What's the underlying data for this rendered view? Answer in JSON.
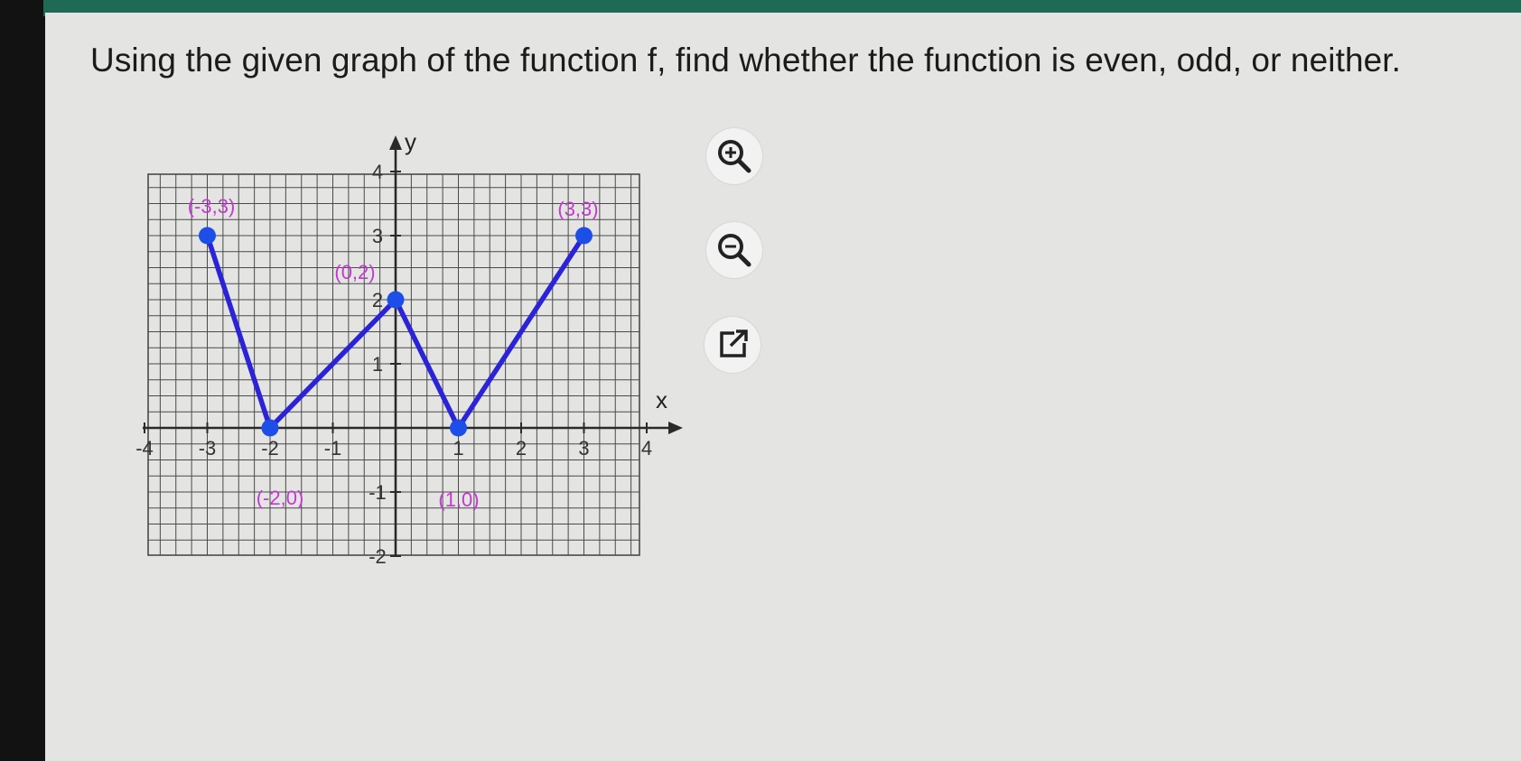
{
  "question": {
    "text": "Using the given graph of the function f, find whether the function is even, odd, or neither."
  },
  "graph": {
    "axis_labels": {
      "x": "x",
      "y": "y"
    },
    "x_ticks": [
      "-4",
      "-3",
      "-2",
      "-1",
      "1",
      "2",
      "3",
      "4"
    ],
    "y_ticks": [
      "4",
      "3",
      "2",
      "1",
      "-1",
      "-2"
    ],
    "point_labels": [
      "(-3,3)",
      "(0,2)",
      "(3,3)",
      "(-2,0)",
      "(1,0)"
    ],
    "colors": {
      "line": "#2b23d8",
      "point": "#1d4fe8",
      "label": "#c23ad0",
      "grid": "#4a4a4a"
    }
  },
  "chart_data": {
    "type": "line",
    "x": [
      -3,
      -2,
      0,
      1,
      3
    ],
    "y": [
      3,
      0,
      2,
      0,
      3
    ],
    "xlabel": "x",
    "ylabel": "y",
    "xlim": [
      -4,
      4
    ],
    "ylim": [
      -2,
      4
    ],
    "grid": true
  },
  "tools": {
    "zoom_in_icon": "zoom-in-icon",
    "zoom_out_icon": "zoom-out-icon",
    "popout_icon": "external-link-icon"
  }
}
